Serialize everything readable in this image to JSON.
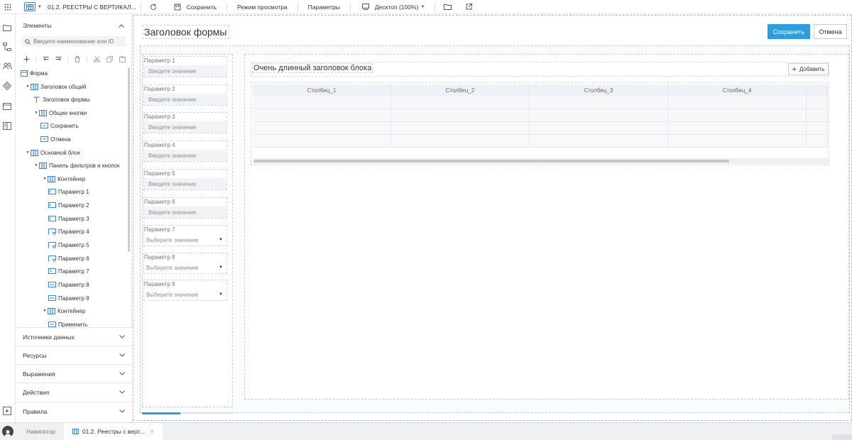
{
  "toolbar": {
    "doc_title": "01.2. РЕЕСТРЫ С ВЕРТИКАЛ...",
    "save": "Сохранить",
    "view_mode": "Режим просмотра",
    "params": "Параметры",
    "device": "Десктоп (100%)"
  },
  "panel": {
    "elements_title": "Элементы",
    "search_placeholder": "Введите наименование или ID",
    "tree": [
      {
        "label": "Форма",
        "icon": "form-icon"
      },
      {
        "label": "Заголовок общий",
        "icon": "container-icon"
      },
      {
        "label": "Заголовок формы",
        "icon": "text-icon"
      },
      {
        "label": "Общие кнопки",
        "icon": "container-icon"
      },
      {
        "label": "Сохранить",
        "icon": "button-icon"
      },
      {
        "label": "Отмена",
        "icon": "button-icon"
      },
      {
        "label": "Основной блок",
        "icon": "container-icon"
      },
      {
        "label": "Панель фильтров и кнопок",
        "icon": "container-icon"
      },
      {
        "label": "Контейнер",
        "icon": "container-icon"
      },
      {
        "label": "Параметр 1",
        "icon": "input-icon"
      },
      {
        "label": "Параметр 2",
        "icon": "input-icon"
      },
      {
        "label": "Параметр 3",
        "icon": "input-icon"
      },
      {
        "label": "Параметр 4",
        "icon": "select-icon"
      },
      {
        "label": "Параметр 5",
        "icon": "select-icon"
      },
      {
        "label": "Параметр 6",
        "icon": "select-icon"
      },
      {
        "label": "Параметр 7",
        "icon": "input-icon"
      },
      {
        "label": "Параметр 8",
        "icon": "input-icon"
      },
      {
        "label": "Параметр 9",
        "icon": "input-icon"
      },
      {
        "label": "Контейнер",
        "icon": "container-icon"
      },
      {
        "label": "Применить",
        "icon": "button-icon"
      }
    ],
    "sections": [
      "Источники данных",
      "Ресурсы",
      "Выражения",
      "Действия",
      "Правила"
    ]
  },
  "canvas": {
    "form_title": "Заголовок формы",
    "save_button": "Сохранить",
    "cancel_button": "Отмена",
    "filters": [
      {
        "label": "Параметр 1",
        "placeholder": "Введите значение",
        "type": "input"
      },
      {
        "label": "Параметр 2",
        "placeholder": "Введите значение",
        "type": "input"
      },
      {
        "label": "Параметр 3",
        "placeholder": "Введите значение",
        "type": "input"
      },
      {
        "label": "Параметр 4",
        "placeholder": "Введите значение",
        "type": "input"
      },
      {
        "label": "Параметр 5",
        "placeholder": "Введите значение",
        "type": "input"
      },
      {
        "label": "Параметр 6",
        "placeholder": "Введите значение",
        "type": "input"
      },
      {
        "label": "Параметр 7",
        "placeholder": "Выберите значение",
        "type": "select"
      },
      {
        "label": "Параметр 8",
        "placeholder": "Выберите значение",
        "type": "select"
      },
      {
        "label": "Параметр 9",
        "placeholder": "Выберите значение",
        "type": "select"
      }
    ],
    "block_title": "Очень длинный заголовок блока",
    "add_button": "Добавить",
    "columns": [
      "Столбец_1",
      "Столбец_2",
      "Столбец_3",
      "Столбец_4"
    ]
  },
  "bottom": {
    "navigator": "Навигатор",
    "active_tab": "01.2. Реестры с верт..."
  },
  "colors": {
    "accent": "#2d9de0",
    "frame": "#9cc3e6"
  }
}
